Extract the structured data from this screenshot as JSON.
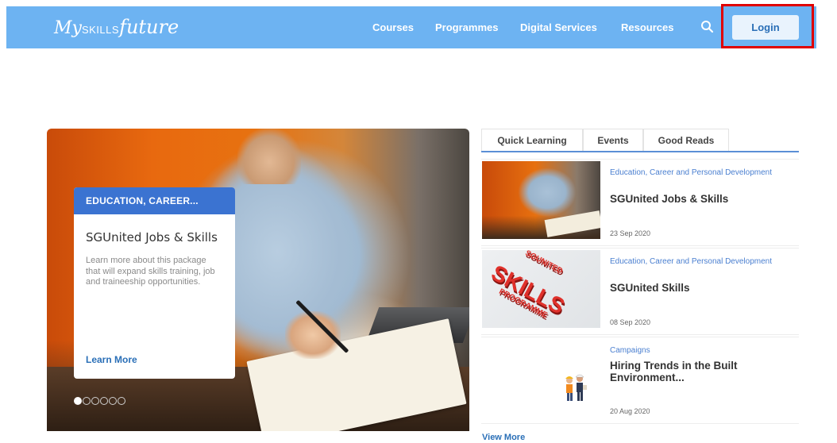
{
  "header": {
    "logo": {
      "my": "My",
      "skills": "SKILLS",
      "future": "future"
    },
    "nav": [
      "Courses",
      "Programmes",
      "Digital Services",
      "Resources"
    ],
    "search_icon": "search-icon",
    "login_label": "Login",
    "colors": {
      "bar": "#6db3f2",
      "highlight": "#e00000"
    }
  },
  "hero": {
    "category": "EDUCATION, CAREER...",
    "title": "SGUnited Jobs & Skills",
    "description": "Learn more about this package that will expand skills training, job and traineeship opportunities.",
    "link": "Learn More",
    "slide_count": 6,
    "active_slide": 1
  },
  "tabs": [
    "Quick Learning",
    "Events",
    "Good Reads"
  ],
  "feed": [
    {
      "category": "Education, Career and Personal Development",
      "title": "SGUnited Jobs & Skills",
      "date": "23 Sep 2020"
    },
    {
      "category": "Education, Career and Personal Development",
      "title": "SGUnited Skills",
      "date": "08 Sep 2020",
      "thumb_words": [
        "SGUNITED",
        "SKILLS",
        "PROGRAMME"
      ]
    },
    {
      "category": "Campaigns",
      "title": "Hiring Trends in the Built Environment...",
      "date": "20 Aug 2020"
    }
  ],
  "view_more": "View More"
}
